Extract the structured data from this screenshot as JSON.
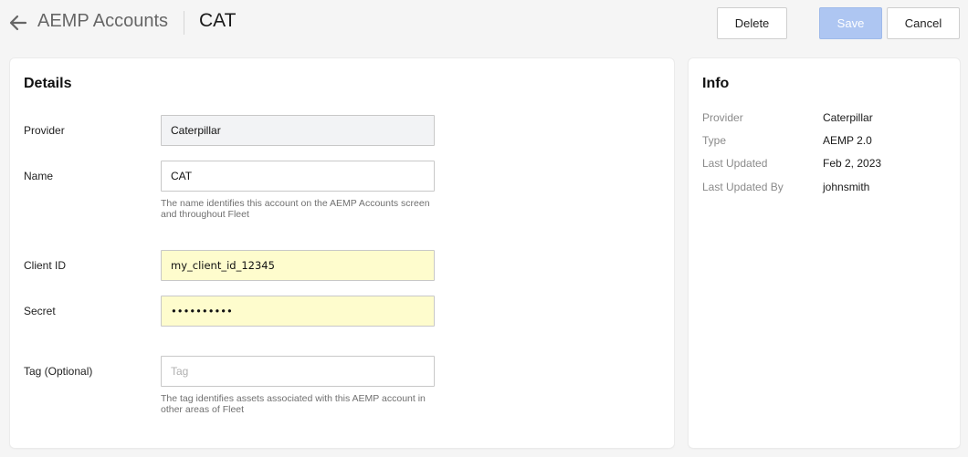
{
  "header": {
    "breadcrumb": "AEMP Accounts",
    "title": "CAT",
    "buttons": {
      "delete": "Delete",
      "save": "Save",
      "cancel": "Cancel"
    }
  },
  "details": {
    "title": "Details",
    "provider": {
      "label": "Provider",
      "value": "Caterpillar"
    },
    "name": {
      "label": "Name",
      "value": "CAT",
      "help": "The name identifies this account on the AEMP Accounts screen and throughout Fleet"
    },
    "client_id": {
      "label": "Client ID",
      "value": "my_client_id_12345"
    },
    "secret": {
      "label": "Secret",
      "value": "••••••••••"
    },
    "tag": {
      "label": "Tag (Optional)",
      "value": "",
      "placeholder": "Tag",
      "help": "The tag identifies assets associated with this AEMP account in other areas of Fleet"
    }
  },
  "info": {
    "title": "Info",
    "rows": [
      {
        "key": "Provider",
        "value": "Caterpillar"
      },
      {
        "key": "Type",
        "value": "AEMP 2.0"
      },
      {
        "key": "Last Updated",
        "value": "Feb 2, 2023"
      },
      {
        "key": "Last Updated By",
        "value": "johnsmith"
      }
    ]
  },
  "colors": {
    "save_disabled": "#aec6f2",
    "autofill": "#fefccd",
    "readonly": "#f2f3f5"
  }
}
